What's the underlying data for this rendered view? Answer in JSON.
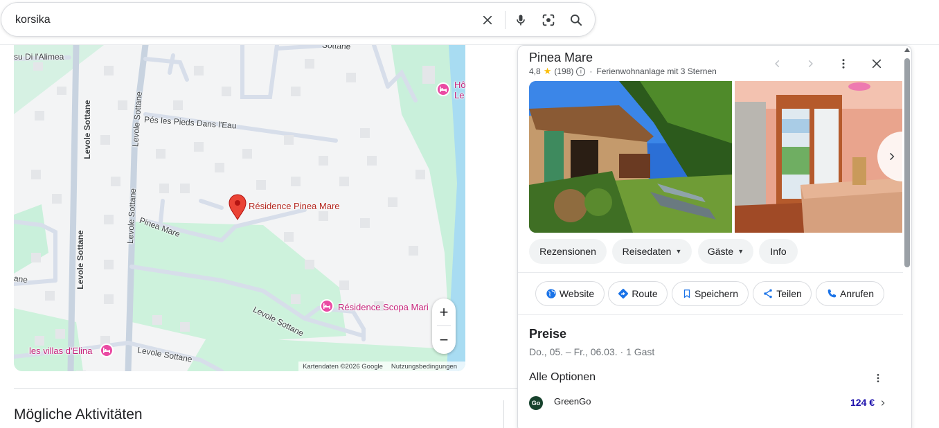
{
  "search": {
    "query": "korsika"
  },
  "map": {
    "roads": {
      "alimea": "su Di l'Alimea",
      "sottane_top": "Sottane",
      "levole_v1": "Levole Sottane",
      "levole_v2": "Levole Sottane",
      "levole_v3": "Levole Sottane",
      "pes_pieds": "Pés les Pieds Dans l'Eau",
      "pinea": "Pinea Mare",
      "levole_diag": "Levole Sottane",
      "levole_bottom": "Levole Sottane",
      "ane": "ane"
    },
    "pois": {
      "hotel_top": "Hô",
      "hotel_top2": "Le",
      "scopa": "Résidence Scopa Mari",
      "villas": "les villas d'Elina"
    },
    "pin_label": "Résidence Pinea Mare",
    "zoom_in": "+",
    "zoom_out": "−",
    "attribution": {
      "data": "Kartendaten ©2026 Google",
      "terms": "Nutzungsbedingungen"
    }
  },
  "activities": {
    "title": "Mögliche Aktivitäten"
  },
  "panel": {
    "name": "Pinea Mare",
    "rating": "4,8",
    "reviews_count": "(198)",
    "category": "Ferienwohnanlage mit 3 Sternen",
    "chips": [
      {
        "label": "Rezensionen"
      },
      {
        "label": "Reisedaten"
      },
      {
        "label": "Gäste"
      },
      {
        "label": "Info"
      }
    ],
    "actions": [
      {
        "label": "Website",
        "icon": "globe-icon"
      },
      {
        "label": "Route",
        "icon": "directions-icon"
      },
      {
        "label": "Speichern",
        "icon": "bookmark-icon"
      },
      {
        "label": "Teilen",
        "icon": "share-icon"
      },
      {
        "label": "Anrufen",
        "icon": "phone-icon"
      }
    ],
    "prices": {
      "title": "Preise",
      "dates": "Do., 05. – Fr., 06.03. · 1 Gast",
      "all_options": "Alle Optionen",
      "offers": [
        {
          "logo": "Go",
          "provider": "GreenGo",
          "price": "124 €"
        }
      ]
    }
  },
  "colors": {
    "accent_blue": "#1a73e8",
    "price_blue": "#1a0dab",
    "poi_pink": "#c5227a",
    "pin_red": "#ea4335"
  }
}
